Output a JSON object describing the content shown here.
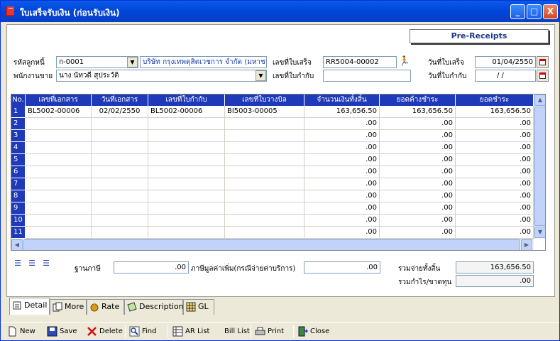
{
  "window": {
    "title": "ใบเสร็จรับเงิน (ก่อนรับเงิน)",
    "min": "_",
    "max": "□",
    "close": "X"
  },
  "header_button": "Pre-Receipts",
  "form": {
    "customer_code_label": "รหัสลูกหนี้",
    "customer_code": "ก-0001",
    "customer_name": "บริษัท กรุงเทพดุสิตเวชการ จำกัด (มหาชน)",
    "salesperson_label": "พนักงานขาย",
    "salesperson": "นาง นัทวดี สุประวัติ",
    "receipt_no_label": "เลขที่ใบเสร็จ",
    "receipt_no": "RR5004-00002",
    "tax_invoice_no_label": "เลขที่ใบกำกับ",
    "tax_invoice_no": "",
    "receipt_date_label": "วันที่ใบเสร็จ",
    "receipt_date": "01/04/2550",
    "tax_invoice_date_label": "วันที่ใบกำกับ",
    "tax_invoice_date": "/ /"
  },
  "grid": {
    "headers": [
      "No.",
      "เลขที่เอกสาร",
      "วันที่เอกสาร",
      "เลขที่ใบกำกับ",
      "เลขที่ใบวางบิล",
      "จำนวนเงินทั้งสิ้น",
      "ยอดค้างชำระ",
      "ยอดชำระ"
    ],
    "rows": [
      [
        "1",
        "BL5002-00006",
        "02/02/2550",
        "BL5002-00006",
        "BI5003-00005",
        "163,656.50",
        "163,656.50",
        "163,656.50"
      ],
      [
        "2",
        "",
        "",
        "",
        "",
        ".00",
        ".00",
        ".00"
      ],
      [
        "3",
        "",
        "",
        "",
        "",
        ".00",
        ".00",
        ".00"
      ],
      [
        "4",
        "",
        "",
        "",
        "",
        ".00",
        ".00",
        ".00"
      ],
      [
        "5",
        "",
        "",
        "",
        "",
        ".00",
        ".00",
        ".00"
      ],
      [
        "6",
        "",
        "",
        "",
        "",
        ".00",
        ".00",
        ".00"
      ],
      [
        "7",
        "",
        "",
        "",
        "",
        ".00",
        ".00",
        ".00"
      ],
      [
        "8",
        "",
        "",
        "",
        "",
        ".00",
        ".00",
        ".00"
      ],
      [
        "9",
        "",
        "",
        "",
        "",
        ".00",
        ".00",
        ".00"
      ],
      [
        "10",
        "",
        "",
        "",
        "",
        ".00",
        ".00",
        ".00"
      ],
      [
        "11",
        "",
        "",
        "",
        "",
        ".00",
        ".00",
        ".00"
      ]
    ]
  },
  "totals": {
    "tax_base_label": "ฐานภาษี",
    "tax_base": ".00",
    "vat_label": "ภาษีมูลค่าเพิ่ม(กรณีจ่ายค่าบริการ)",
    "vat": ".00",
    "total_paid_label": "รวมจ่ายทั้งสิ้น",
    "total_paid": "163,656.50",
    "profit_loss_label": "รวมกำไร/ขาดทุน",
    "profit_loss": ".00"
  },
  "tabs": [
    "Detail",
    "More",
    "Rate",
    "Description",
    "GL"
  ],
  "toolbar": [
    "New",
    "Save",
    "Delete",
    "Find",
    "AR List",
    "Bill List",
    "Print",
    "Close"
  ],
  "icons": {
    "app": "receipt-book-icon",
    "run": "running-man-icon",
    "calendar": "calendar-icon"
  },
  "colors": {
    "grid_header": "#1e3ab8",
    "titlebar": "#0a5ae8",
    "close_button": "#d4461e"
  }
}
